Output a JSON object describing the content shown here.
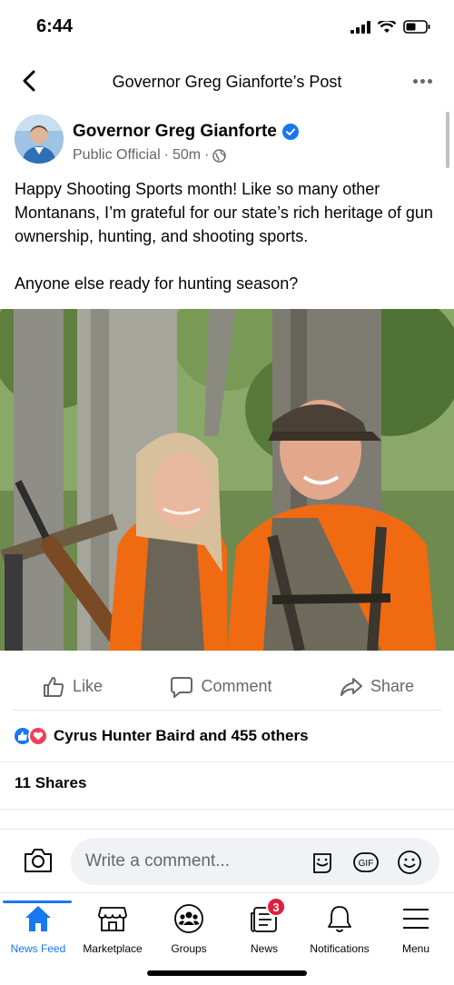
{
  "status_bar": {
    "time": "6:44"
  },
  "header": {
    "title": "Governor Greg Gianforte’s Post"
  },
  "post": {
    "author": "Governor Greg Gianforte",
    "role": "Public Official",
    "time": "50m",
    "paragraph_1": "Happy Shooting Sports month! Like so many other Montanans, I’m grateful for our state’s rich heritage of gun ownership, hunting, and shooting sports.",
    "paragraph_2": "Anyone else ready for hunting season?"
  },
  "actions": {
    "like": "Like",
    "comment": "Comment",
    "share": "Share"
  },
  "reactions": {
    "text": "Cyrus Hunter Baird and 455 others"
  },
  "shares": "11 Shares",
  "comment_bar": {
    "placeholder": "Write a comment..."
  },
  "tabs": [
    {
      "label": "News Feed",
      "icon": "home-icon"
    },
    {
      "label": "Marketplace",
      "icon": "marketplace-icon"
    },
    {
      "label": "Groups",
      "icon": "groups-icon"
    },
    {
      "label": "News",
      "icon": "news-icon",
      "badge": "3"
    },
    {
      "label": "Notifications",
      "icon": "bell-icon"
    },
    {
      "label": "Menu",
      "icon": "menu-icon"
    }
  ],
  "colors": {
    "accent": "#1877f2",
    "badge": "#e41e3f",
    "muted": "#65676b"
  }
}
